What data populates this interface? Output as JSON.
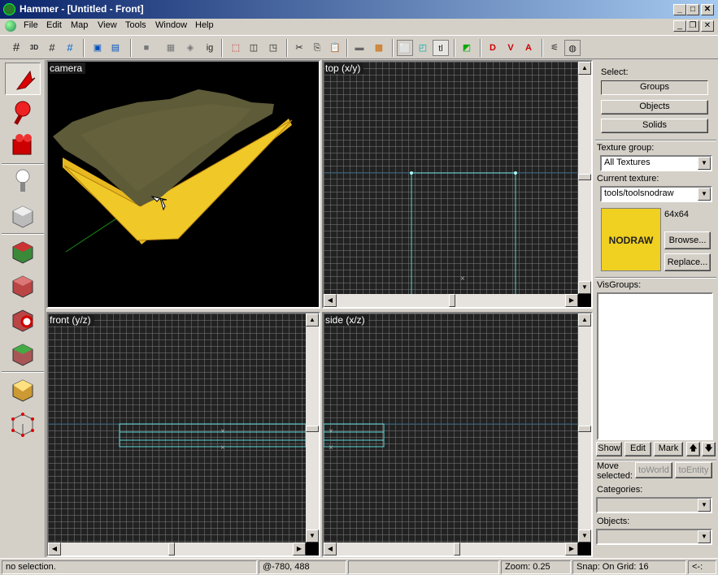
{
  "window": {
    "title": "Hammer - [Untitled - Front]",
    "minimize": "_",
    "maximize": "□",
    "close": "✕"
  },
  "menu": [
    "File",
    "Edit",
    "Map",
    "View",
    "Tools",
    "Window",
    "Help"
  ],
  "toolbar": {
    "b3d": "3D",
    "ig": "ig",
    "tl": "tl"
  },
  "viewports": {
    "camera": "camera",
    "top": "top (x/y)",
    "front": "front (y/z)",
    "side": "side (x/z)"
  },
  "left_tools": [
    "selection-tool",
    "magnify-tool",
    "camera-tool",
    "entity-tool",
    "block-tool",
    "texture-application-tool",
    "apply-current-texture-tool",
    "decal-tool",
    "overlay-tool",
    "clipping-tool",
    "vertex-tool"
  ],
  "panel": {
    "select_label": "Select:",
    "groups": "Groups",
    "objects": "Objects",
    "solids": "Solids",
    "texture_group_label": "Texture group:",
    "texture_group_value": "All Textures",
    "current_texture_label": "Current texture:",
    "current_texture_value": "tools/toolsnodraw",
    "texture_size": "64x64",
    "texture_preview_text": "NODRAW",
    "browse": "Browse...",
    "replace": "Replace...",
    "visgroups_label": "VisGroups:",
    "show": "Show",
    "edit": "Edit",
    "mark": "Mark",
    "up": "🡅",
    "down": "🡇",
    "move_selected_label": "Move selected:",
    "to_world": "toWorld",
    "to_entity": "toEntity",
    "categories_label": "Categories:",
    "objects_label": "Objects:"
  },
  "status": {
    "selection": "no selection.",
    "coords": "@-780, 488",
    "zoom": "Zoom: 0.25",
    "snap": "Snap: On Grid: 16",
    "arrow": "<-:"
  },
  "colors": {
    "accent_title": "#0a246a",
    "nodraw": "#f0d020",
    "brush_outline": "#5fd6d6"
  }
}
